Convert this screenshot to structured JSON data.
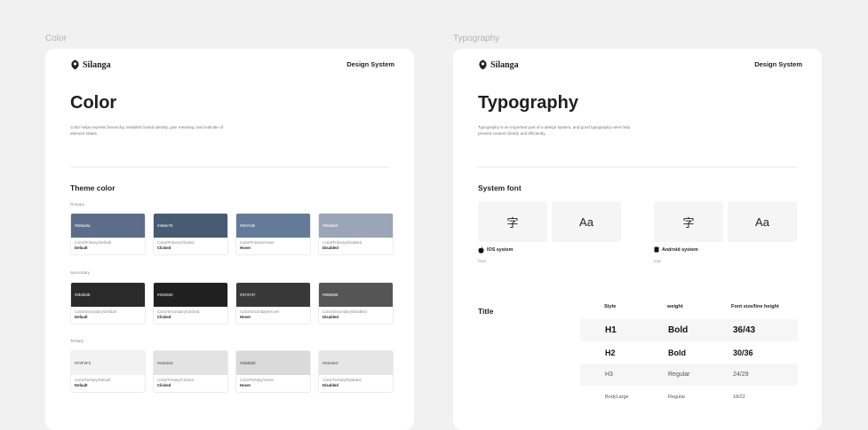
{
  "frames": {
    "color_label": "Color",
    "typography_label": "Typography"
  },
  "color_board": {
    "brand": "Silanga",
    "design_system": "Design System",
    "title": "Color",
    "description": "Color helps express hierarchy, establish brand identity, give meaning, and indicate of element states.",
    "theme_title": "Theme color",
    "groups": {
      "primary": {
        "label": "Primary",
        "swatches": [
          {
            "hex": "#506a8a",
            "color": "#5b6d88",
            "name": "Color/Primary/Default",
            "state": "Default",
            "text": "#ffffff"
          },
          {
            "hex": "#465e75",
            "color": "#475b72",
            "name": "Color/Primary/Clicked",
            "state": "Clicked",
            "text": "#ffffff"
          },
          {
            "hex": "#607c9b",
            "color": "#637b99",
            "name": "Color/Primary/Hover",
            "state": "Hover",
            "text": "#ffffff"
          },
          {
            "hex": "#99a8b9",
            "color": "#9aa5b6",
            "name": "Color/Primary/Disabled",
            "state": "Disabled",
            "text": "#ffffff"
          }
        ]
      },
      "secondary": {
        "label": "Secondary",
        "swatches": [
          {
            "hex": "#2b2b2b",
            "color": "#2a2a2a",
            "name": "Color/Secondary/Default",
            "state": "Default",
            "text": "#ffffff"
          },
          {
            "hex": "#202020",
            "color": "#202020",
            "name": "Color/Secondary/Clicked",
            "state": "Clicked",
            "text": "#ffffff"
          },
          {
            "hex": "#373737",
            "color": "#383838",
            "name": "Color/Secondary/Hover",
            "state": "Hover",
            "text": "#ffffff"
          },
          {
            "hex": "#555555",
            "color": "#555555",
            "name": "Color/Secondary/Disabled",
            "state": "Disabled",
            "text": "#ffffff"
          }
        ]
      },
      "tertiary": {
        "label": "Tertiary",
        "swatches": [
          {
            "hex": "#F2F2F2",
            "color": "#f2f2f2",
            "name": "Color/Tertiary/Default",
            "state": "Default",
            "text": "#444444"
          },
          {
            "hex": "#e3e3e3",
            "color": "#e3e3e3",
            "name": "Color/Tertiary/Clicked",
            "state": "Clicked",
            "text": "#444444"
          },
          {
            "hex": "#dddddd",
            "color": "#dadada",
            "name": "Color/Tertiary/Hover",
            "state": "Hover",
            "text": "#444444"
          },
          {
            "hex": "#e3e3e3",
            "color": "#e6e6e6",
            "name": "Color/Tertiary/Disabled",
            "state": "Disabled",
            "text": "#444444"
          }
        ]
      }
    }
  },
  "typography_board": {
    "brand": "Silanga",
    "design_system": "Design System",
    "title": "Typography",
    "description": "Typography is an important part of a design system, and good typography rules help present content clearly and efficiently.",
    "system_font_title": "System font",
    "ios": {
      "glyph": "字",
      "latin": "Aa",
      "label": "IOS system",
      "sub": "Pixel"
    },
    "android": {
      "glyph": "字",
      "latin": "Aa",
      "label": "Android system",
      "sub": "Inter"
    },
    "title_section": "Title",
    "table": {
      "headers": {
        "style": "Style",
        "weight": "weight",
        "size": "Font size/line height"
      },
      "rows": [
        {
          "style": "H1",
          "weight": "Bold",
          "size": "36/43",
          "bold": true
        },
        {
          "style": "H2",
          "weight": "Bold",
          "size": "30/36",
          "bold": true
        },
        {
          "style": "H3",
          "weight": "Regular",
          "size": "24/29",
          "bold": false
        },
        {
          "style": "BodyLarge",
          "weight": "Regular",
          "size": "18/22",
          "bold": false
        }
      ]
    }
  }
}
